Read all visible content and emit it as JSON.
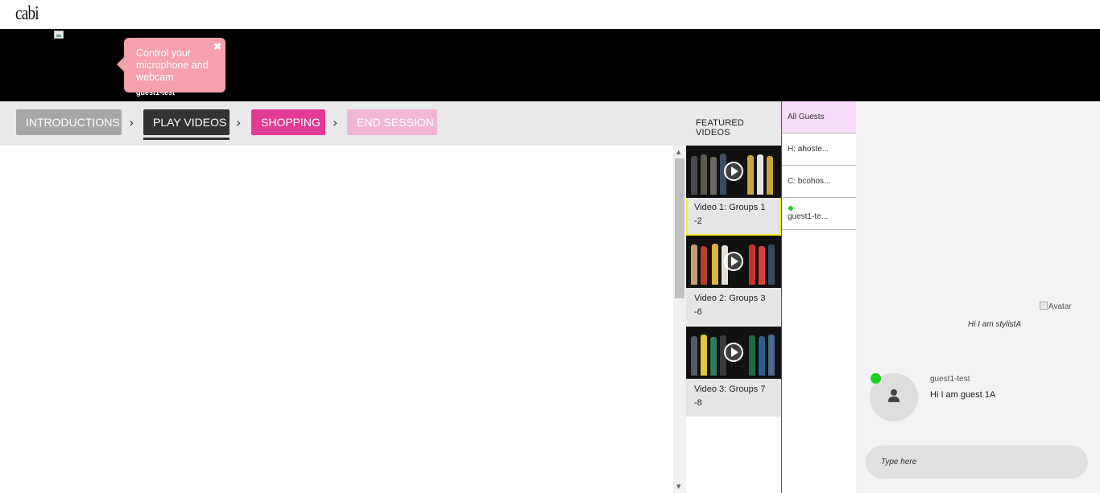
{
  "header": {
    "logo_text": "cabi"
  },
  "video_strip": {
    "stream_label": "guest1-test",
    "tooltip_text": "Control your microphone and webcam",
    "tooltip_close": "✖"
  },
  "steps": {
    "intro": "INTRODUCTIONS",
    "play": "PLAY VIDEOS",
    "shop": "SHOPPING",
    "end": "END SESSION",
    "separator": "›"
  },
  "featured_label": "FEATURED VIDEOS",
  "videos": [
    {
      "title": "Video 1: Groups 1 -2",
      "active": true
    },
    {
      "title": "Video 2: Groups 3 -6",
      "active": false
    },
    {
      "title": "Video 3: Groups 7 -8",
      "active": false
    }
  ],
  "guests": {
    "all": "All Guests",
    "items": [
      {
        "label": "H: ahoste..."
      },
      {
        "label": "C: bcohos..."
      },
      {
        "label": "guest1-te...",
        "online": true
      }
    ]
  },
  "chat": {
    "avatar_alt": "Avatar",
    "stylist_message": "Hi I am stylistA",
    "guest_name": "guest1-test",
    "guest_message": "Hi I am guest 1A",
    "input_placeholder": "Type here"
  },
  "colors": {
    "shopping": "#e33a94",
    "end_session": "#f2b6d4",
    "tooltip": "#f7a1ad",
    "active_border": "#f0ec36",
    "online": "#1bd11b"
  }
}
